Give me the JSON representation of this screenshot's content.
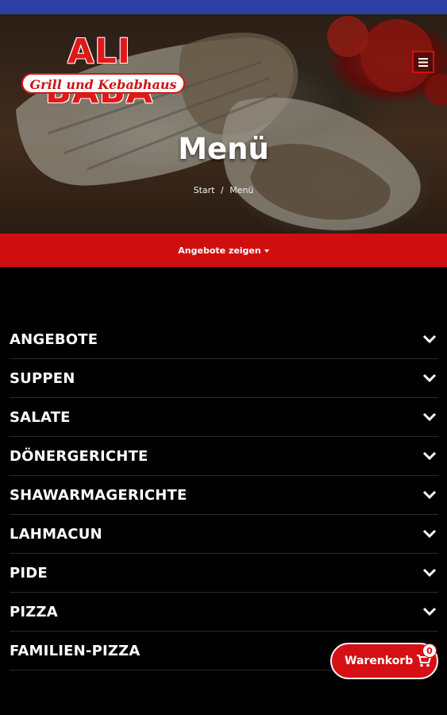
{
  "header": {
    "logo": {
      "title": "ALI BABA",
      "subtitle": "Grill und Kebabhaus"
    },
    "hero_title": "Menü",
    "breadcrumb": {
      "home": "Start",
      "separator": "/",
      "current": "Menü"
    },
    "menu_icon": "hamburger-menu-icon"
  },
  "offers_bar": {
    "label": "Angebote zeigen",
    "icon": "caret-down-icon"
  },
  "categories": [
    {
      "label": "ANGEBOTE"
    },
    {
      "label": "SUPPEN"
    },
    {
      "label": "SALATE"
    },
    {
      "label": "DÖNERGERICHTE"
    },
    {
      "label": "SHAWARMAGERICHTE"
    },
    {
      "label": "LAHMACUN"
    },
    {
      "label": "PIDE"
    },
    {
      "label": "PIZZA"
    },
    {
      "label": "FAMILIEN-PIZZA"
    }
  ],
  "cart": {
    "label": "Warenkorb",
    "count": "0",
    "icon": "shopping-cart-icon"
  },
  "colors": {
    "brand_red": "#cf0f0f",
    "top_bar": "#2e3fa3",
    "background": "#000000"
  }
}
